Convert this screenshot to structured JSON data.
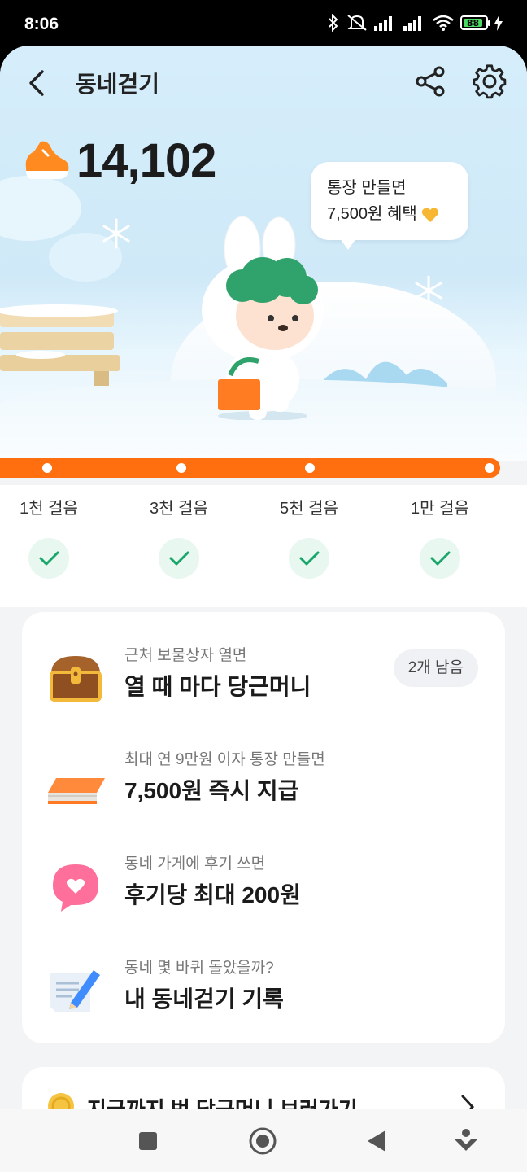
{
  "status": {
    "time": "8:06",
    "battery": "88"
  },
  "header": {
    "title": "동네걷기"
  },
  "steps": {
    "count": "14,102"
  },
  "bubble": {
    "line1": "통장 만들면",
    "line2": "7,500원 혜택"
  },
  "milestones": [
    {
      "label": "1천 걸음"
    },
    {
      "label": "3천 걸음"
    },
    {
      "label": "5천 걸음"
    },
    {
      "label": "1만 걸음"
    }
  ],
  "rewards": [
    {
      "subtitle": "근처 보물상자 열면",
      "title": "열 때 마다 당근머니",
      "badge": "2개 남음",
      "icon": "treasure-chest-icon"
    },
    {
      "subtitle": "최대 연 9만원 이자 통장 만들면",
      "title": "7,500원 즉시 지급",
      "icon": "bankbook-icon"
    },
    {
      "subtitle": "동네 가게에 후기 쓰면",
      "title": "후기당 최대 200원",
      "icon": "heart-bubble-icon"
    },
    {
      "subtitle": "동네 몇 바퀴 돌았을까?",
      "title": "내 동네걷기 기록",
      "icon": "notepad-pen-icon"
    }
  ],
  "bottom_card": {
    "title": "지금까지 번 당근머니 보러가기"
  },
  "colors": {
    "accent": "#ff6f0f",
    "check": "#18a66a"
  }
}
